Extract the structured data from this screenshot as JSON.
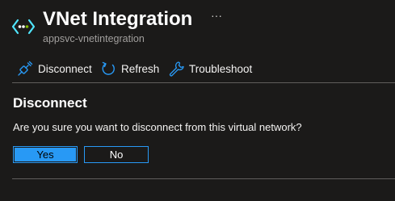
{
  "header": {
    "title": "VNet Integration",
    "subtitle": "appsvc-vnetintegration",
    "icon": "vnet-integration-icon",
    "more_label": "···"
  },
  "toolbar": {
    "items": [
      {
        "label": "Disconnect",
        "icon": "disconnect-plug-icon"
      },
      {
        "label": "Refresh",
        "icon": "refresh-icon"
      },
      {
        "label": "Troubleshoot",
        "icon": "wrench-icon"
      }
    ]
  },
  "dialog": {
    "title": "Disconnect",
    "message": "Are you sure you want to disconnect from this virtual network?",
    "confirm_label": "Yes",
    "cancel_label": "No"
  },
  "colors": {
    "background": "#1b1a19",
    "accent": "#2899f5",
    "icon_blue": "#50e6ff",
    "divider": "#605e5c",
    "subtitle": "#a19f9d"
  }
}
